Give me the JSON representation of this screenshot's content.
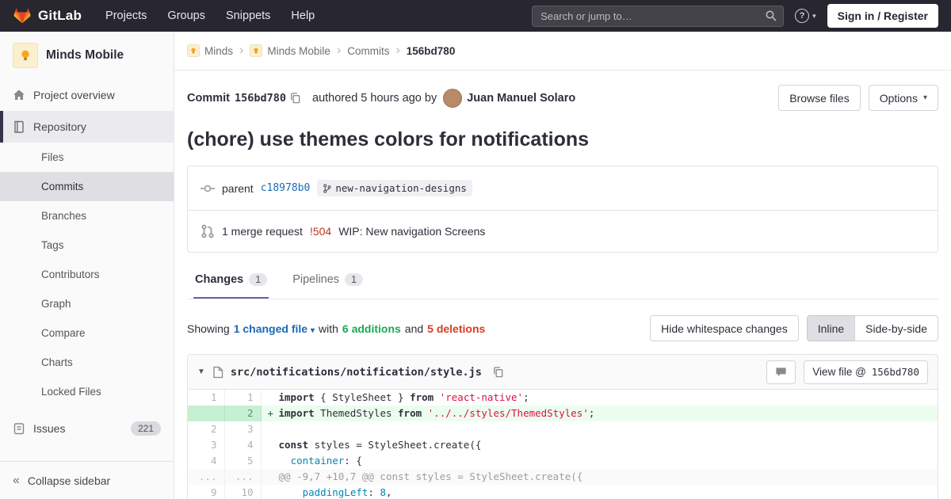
{
  "colors": {
    "brand_orange": "#fc6d26",
    "navbar_bg": "#28272f",
    "link_blue": "#1b69b6",
    "addition_green": "#1aaa55",
    "deletion_red": "#db3b21",
    "tab_accent": "#6762a6"
  },
  "navbar": {
    "logo_text": "GitLab",
    "menu": [
      "Projects",
      "Groups",
      "Snippets",
      "Help"
    ],
    "search_placeholder": "Search or jump to…",
    "help_glyph": "?",
    "sign_in": "Sign in / Register"
  },
  "sidebar": {
    "project_name": "Minds Mobile",
    "overview_label": "Project overview",
    "repository_label": "Repository",
    "repo_items": [
      "Files",
      "Commits",
      "Branches",
      "Tags",
      "Contributors",
      "Graph",
      "Compare",
      "Charts",
      "Locked Files"
    ],
    "issues_label": "Issues",
    "issues_count": "221",
    "collapse_label": "Collapse sidebar"
  },
  "breadcrumb": {
    "group": "Minds",
    "project": "Minds Mobile",
    "section": "Commits",
    "sha": "156bd780"
  },
  "commit": {
    "label": "Commit",
    "sha": "156bd780",
    "authored_text": "authored 5 hours ago by",
    "author": "Juan Manuel Solaro",
    "browse_files_label": "Browse files",
    "options_label": "Options",
    "title": "(chore) use themes colors for notifications",
    "parent_label": "parent",
    "parent_sha": "c18978b0",
    "branch_ref": "new-navigation-designs",
    "mr_text": "1 merge request",
    "mr_ref": "!504",
    "mr_title": "WIP: New navigation Screens"
  },
  "tabs": {
    "changes_label": "Changes",
    "changes_count": "1",
    "pipelines_label": "Pipelines",
    "pipelines_count": "1"
  },
  "summary": {
    "showing": "Showing",
    "file_dropdown": "1 changed file",
    "with_text": "with",
    "additions": "6 additions",
    "and_text": "and",
    "deletions": "5 deletions",
    "hide_whitespace_label": "Hide whitespace changes",
    "inline_label": "Inline",
    "side_by_side_label": "Side-by-side"
  },
  "diff": {
    "path": "src/notifications/notification/style.js",
    "view_file_prefix": "View file @",
    "view_file_sha": "156bd780",
    "lines": [
      {
        "old": "1",
        "new": "1",
        "type": "",
        "sign": "",
        "code": [
          [
            "import",
            "k"
          ],
          [
            " { StyleSheet } ",
            ""
          ],
          [
            "from",
            "k"
          ],
          [
            " ",
            ""
          ],
          [
            "'react-native'",
            "s"
          ],
          [
            ";",
            ""
          ]
        ]
      },
      {
        "old": "",
        "new": "2",
        "type": "add",
        "sign": "+",
        "code": [
          [
            "import",
            "k"
          ],
          [
            " ThemedStyles ",
            ""
          ],
          [
            "from",
            "k"
          ],
          [
            " ",
            ""
          ],
          [
            "'../../styles/ThemedStyles'",
            "s"
          ],
          [
            ";",
            ""
          ]
        ]
      },
      {
        "old": "2",
        "new": "3",
        "type": "",
        "sign": "",
        "code": []
      },
      {
        "old": "3",
        "new": "4",
        "type": "",
        "sign": "",
        "code": [
          [
            "const",
            "k"
          ],
          [
            " styles = StyleSheet.create({",
            ""
          ]
        ]
      },
      {
        "old": "4",
        "new": "5",
        "type": "",
        "sign": "",
        "code": [
          [
            "  ",
            ""
          ],
          [
            "container",
            "a"
          ],
          [
            ": {",
            ""
          ]
        ]
      },
      {
        "old": "...",
        "new": "...",
        "type": "match",
        "sign": "",
        "code": [
          [
            "@@ -9,7 +10,7 @@ const styles = StyleSheet.create({",
            ""
          ]
        ]
      },
      {
        "old": "9",
        "new": "10",
        "type": "",
        "sign": "",
        "code": [
          [
            "    ",
            ""
          ],
          [
            "paddingLeft",
            "a"
          ],
          [
            ": ",
            ""
          ],
          [
            "8",
            "num"
          ],
          [
            ",",
            ""
          ]
        ]
      }
    ]
  }
}
